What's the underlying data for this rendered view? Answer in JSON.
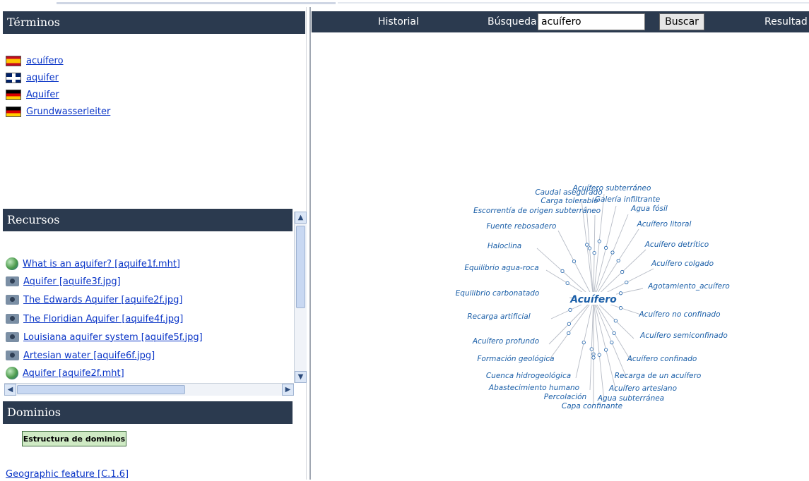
{
  "left_panel": {
    "terminos": {
      "title": "Términos",
      "items": [
        {
          "lang": "es-flag",
          "label": "acuífero"
        },
        {
          "lang": "gb-flag",
          "label": "aquifer"
        },
        {
          "lang": "de-flag",
          "label": "Aquifer"
        },
        {
          "lang": "de-flag",
          "label": "Grundwasserleiter"
        }
      ]
    },
    "recursos": {
      "title": "Recursos",
      "items": [
        {
          "icon": "globe-icon",
          "label": "What is an aquifer? [aquife1f.mht]"
        },
        {
          "icon": "camera-icon",
          "label": "Aquifer [aquife3f.jpg]"
        },
        {
          "icon": "camera-icon",
          "label": "The Edwards Aquifer [aquife2f.jpg]"
        },
        {
          "icon": "camera-icon",
          "label": "The Floridian Aquifer [aquife4f.jpg]"
        },
        {
          "icon": "camera-icon",
          "label": "Louisiana aquifer system [aquife5f.jpg]"
        },
        {
          "icon": "camera-icon",
          "label": "Artesian water [aquife6f.jpg]"
        },
        {
          "icon": "globe-icon",
          "label": "Aquifer [aquife2f.mht]"
        }
      ]
    },
    "dominios": {
      "title": "Dominios",
      "button_label": "Estructura de dominios",
      "link": "Geographic feature [C.1.6]"
    }
  },
  "topbar": {
    "historial": "Historial",
    "busqueda_label": "Búsqueda",
    "search_value": "acuífero",
    "search_button": "Buscar",
    "resultados": "Resultad"
  },
  "graph": {
    "center": "Acuífero",
    "text_color": "#1b5fa8",
    "nodes": [
      "Acuífero subterráneo",
      "Caudal asegurado",
      "Carga tolerable",
      "Galería infiltrante",
      "Agua fósil",
      "Escorrentía de origen subterráneo",
      "Fuente rebosadero",
      "Acuífero litoral",
      "Haloclina",
      "Acuífero detrítico",
      "Equilibrio agua-roca",
      "Acuífero colgado",
      "Agotamiento_acuífero",
      "Equilibrio carbonatado",
      "Recarga artificial",
      "Acuífero no confinado",
      "Acuífero semiconfinado",
      "Acuífero profundo",
      "Formación geológica",
      "Acuífero confinado",
      "Cuenca hidrogeológica",
      "Recarga de un acuífero",
      "Abastecimiento humano",
      "Acuífero artesiano",
      "Percolación",
      "Agua subterránea",
      "Capa confinante"
    ]
  }
}
